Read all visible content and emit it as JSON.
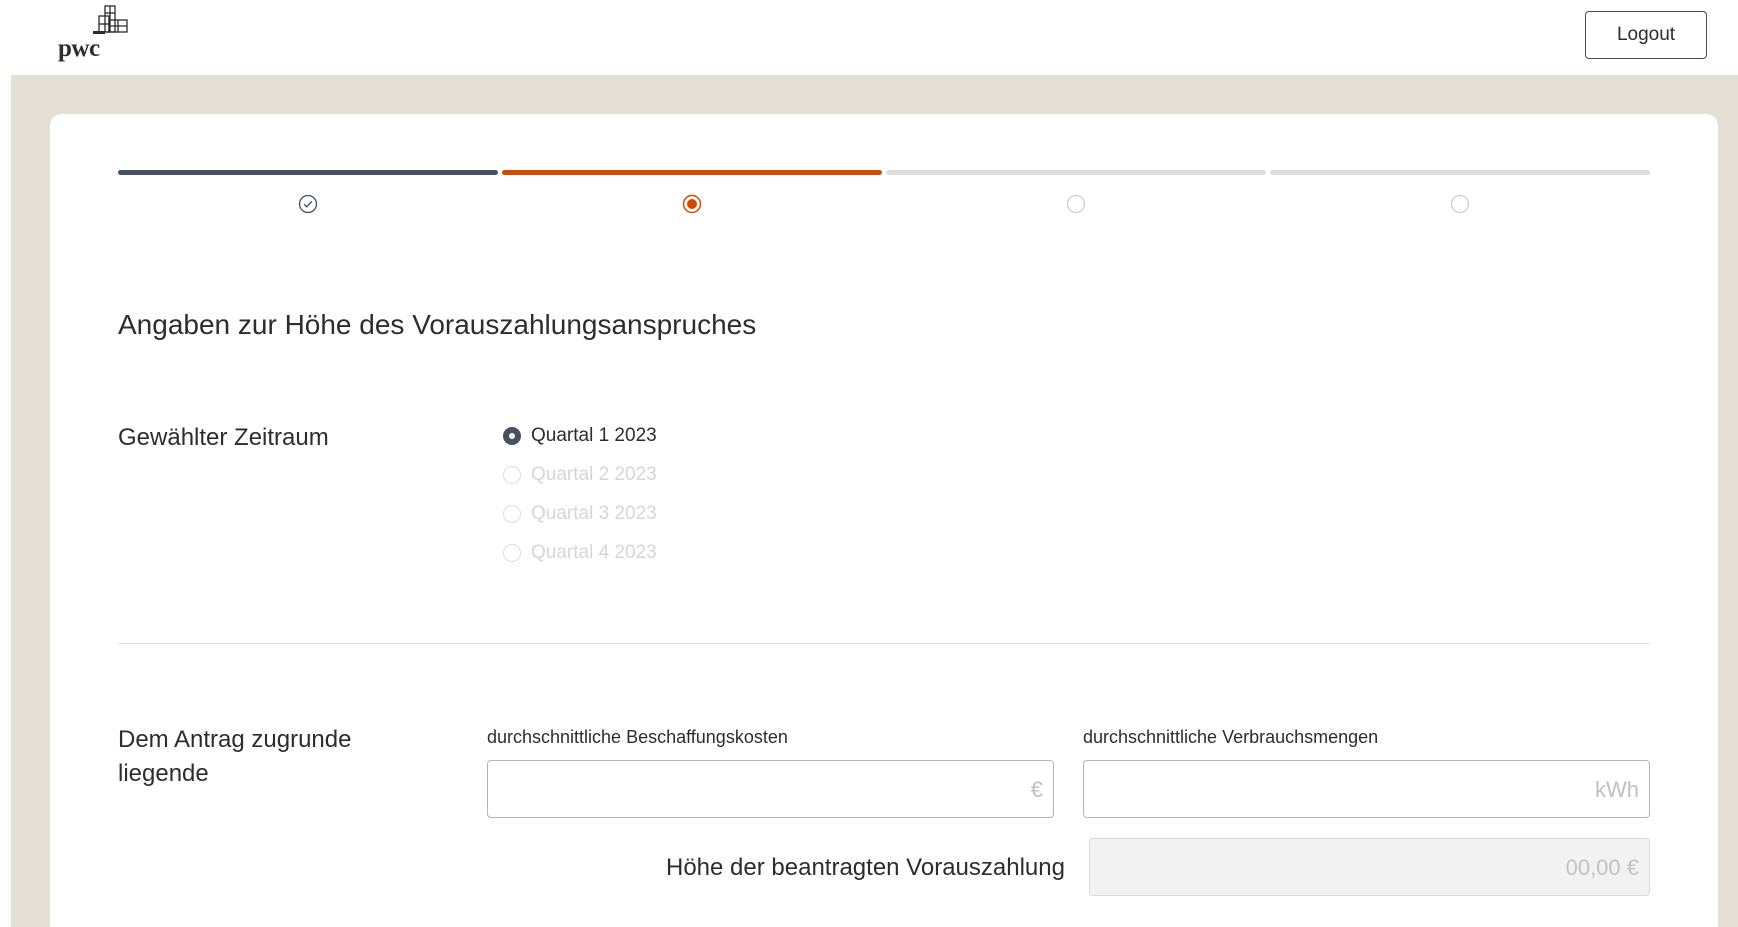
{
  "header": {
    "logo_text": "pwc",
    "logout_label": "Logout"
  },
  "stepper": {
    "steps": [
      {
        "state": "done",
        "icon": "check-circle-icon"
      },
      {
        "state": "active",
        "icon": "radio-dot-icon"
      },
      {
        "state": "todo",
        "icon": "empty-circle-icon"
      },
      {
        "state": "todo",
        "icon": "empty-circle-icon"
      }
    ]
  },
  "form": {
    "title": "Angaben zur Höhe des Vorauszahlungsanspruches",
    "zeitraum": {
      "label": "Gewählter Zeitraum",
      "options": [
        {
          "label": "Quartal 1 2023",
          "checked": true,
          "disabled": false
        },
        {
          "label": "Quartal 2 2023",
          "checked": false,
          "disabled": true
        },
        {
          "label": "Quartal 3 2023",
          "checked": false,
          "disabled": true
        },
        {
          "label": "Quartal 4 2023",
          "checked": false,
          "disabled": true
        }
      ]
    },
    "antrag": {
      "label": "Dem Antrag zugrunde liegende",
      "beschaffung_label": "durchschnittliche Beschaffungskosten",
      "beschaffung_value": "",
      "beschaffung_unit": "€",
      "verbrauch_label": "durchschnittliche Verbrauchsmengen",
      "verbrauch_value": "",
      "verbrauch_unit": "kWh"
    },
    "result": {
      "label": "Höhe der beantragten Vorauszahlung",
      "value": "00,00 €"
    }
  },
  "colors": {
    "brand_orange": "#d04a02",
    "done_slate": "#465061",
    "todo_grey": "#dedede",
    "backdrop": "#e3dfd5"
  }
}
